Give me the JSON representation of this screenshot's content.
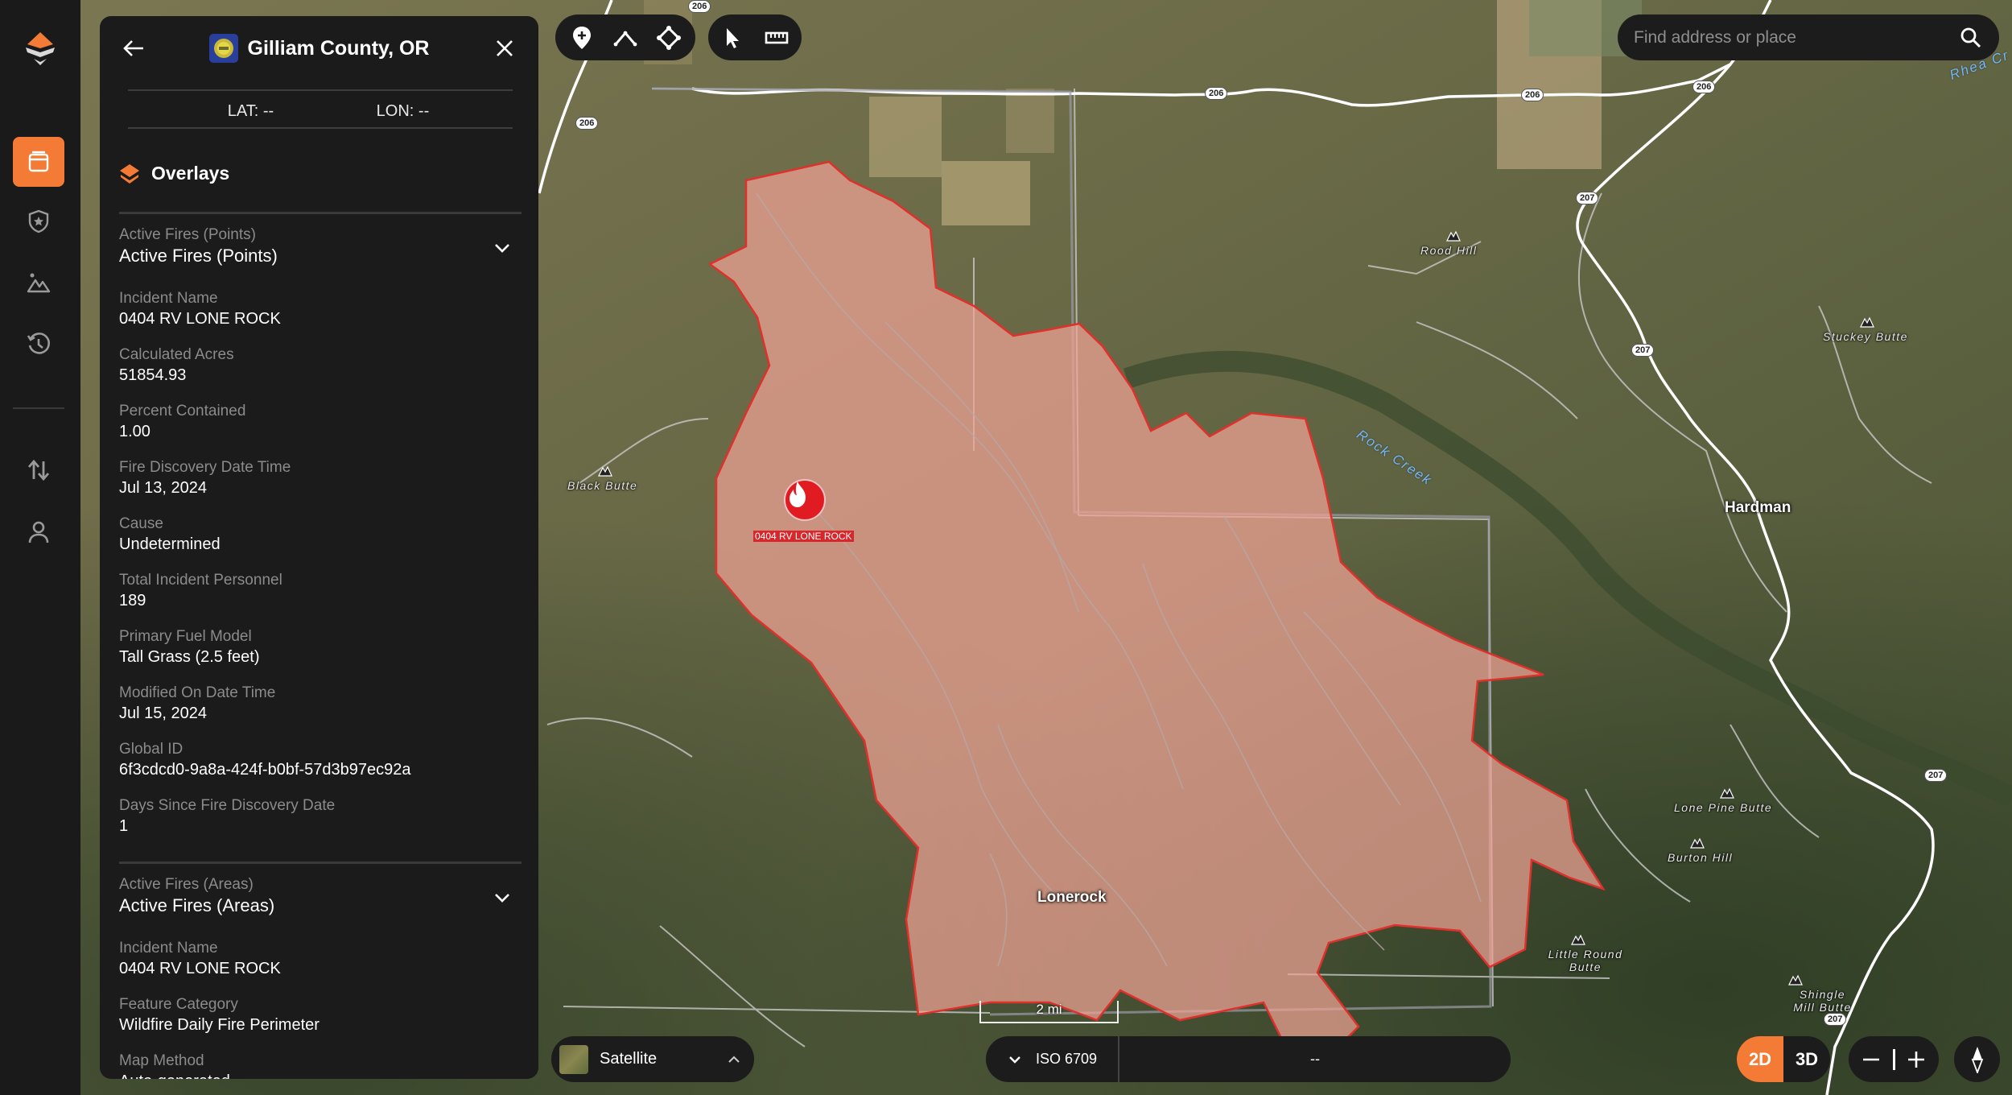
{
  "app": {
    "brand_color": "#f47b35",
    "fire_color": "#e01b22"
  },
  "sidebar": {
    "items": [
      {
        "name": "overlays-panel",
        "icon": "panel-icon",
        "active": true
      },
      {
        "name": "saved",
        "icon": "shield-star-icon",
        "active": false
      },
      {
        "name": "basemaps",
        "icon": "mountain-image-icon",
        "active": false
      },
      {
        "name": "history",
        "icon": "history-icon",
        "active": false
      },
      {
        "name": "sync",
        "icon": "sync-arrows-icon",
        "active": false
      },
      {
        "name": "account",
        "icon": "user-icon",
        "active": false
      }
    ]
  },
  "panel": {
    "title": "Gilliam County, OR",
    "lat": "LAT: --",
    "lon": "LON: --",
    "overlays_heading": "Overlays",
    "sections": [
      {
        "subtitle": "Active Fires (Points)",
        "title": "Active Fires (Points)",
        "fields": [
          {
            "label": "Incident Name",
            "value": "0404 RV LONE ROCK"
          },
          {
            "label": "Calculated Acres",
            "value": "51854.93"
          },
          {
            "label": "Percent Contained",
            "value": "1.00"
          },
          {
            "label": "Fire Discovery Date Time",
            "value": "Jul 13, 2024"
          },
          {
            "label": "Cause",
            "value": "Undetermined"
          },
          {
            "label": "Total Incident Personnel",
            "value": "189"
          },
          {
            "label": "Primary Fuel Model",
            "value": "Tall Grass (2.5 feet)"
          },
          {
            "label": "Modified On Date Time",
            "value": "Jul 15, 2024"
          },
          {
            "label": "Global ID",
            "value": "6f3cdcd0-9a8a-424f-b0bf-57d3b97ec92a"
          },
          {
            "label": "Days Since Fire Discovery Date",
            "value": "1"
          }
        ]
      },
      {
        "subtitle": "Active Fires (Areas)",
        "title": "Active Fires (Areas)",
        "fields": [
          {
            "label": "Incident Name",
            "value": "0404 RV LONE ROCK"
          },
          {
            "label": "Feature Category",
            "value": "Wildfire Daily Fire Perimeter"
          },
          {
            "label": "Map Method",
            "value": "Auto-generated"
          }
        ]
      }
    ]
  },
  "toolbar": {
    "draw_tools": [
      "add-pin-icon",
      "draw-line-icon",
      "draw-polygon-icon"
    ],
    "select_tools": [
      "pointer-icon",
      "ruler-icon"
    ]
  },
  "search": {
    "placeholder": "Find address or place",
    "value": ""
  },
  "basemap": {
    "label": "Satellite"
  },
  "coordbar": {
    "format": "ISO 6709",
    "value": "--"
  },
  "view_mode": {
    "options": [
      "2D",
      "3D"
    ],
    "selected": "2D"
  },
  "map": {
    "fire_marker_label": "0404 RV LONE ROCK",
    "scale_label": "2 mi",
    "towns": [
      "Lonerock",
      "Hardman"
    ],
    "peaks": [
      "Rood Hill",
      "Black Butte",
      "Stuckey Butte",
      "Lone Pine Butte",
      "Burton Hill",
      "Little Round Butte",
      "Shingle Mill Butte"
    ],
    "waters": [
      "Rock Creek",
      "Rhea Cr"
    ],
    "road_shields": [
      "206",
      "206",
      "206",
      "206",
      "206",
      "207",
      "207",
      "207",
      "207"
    ]
  }
}
